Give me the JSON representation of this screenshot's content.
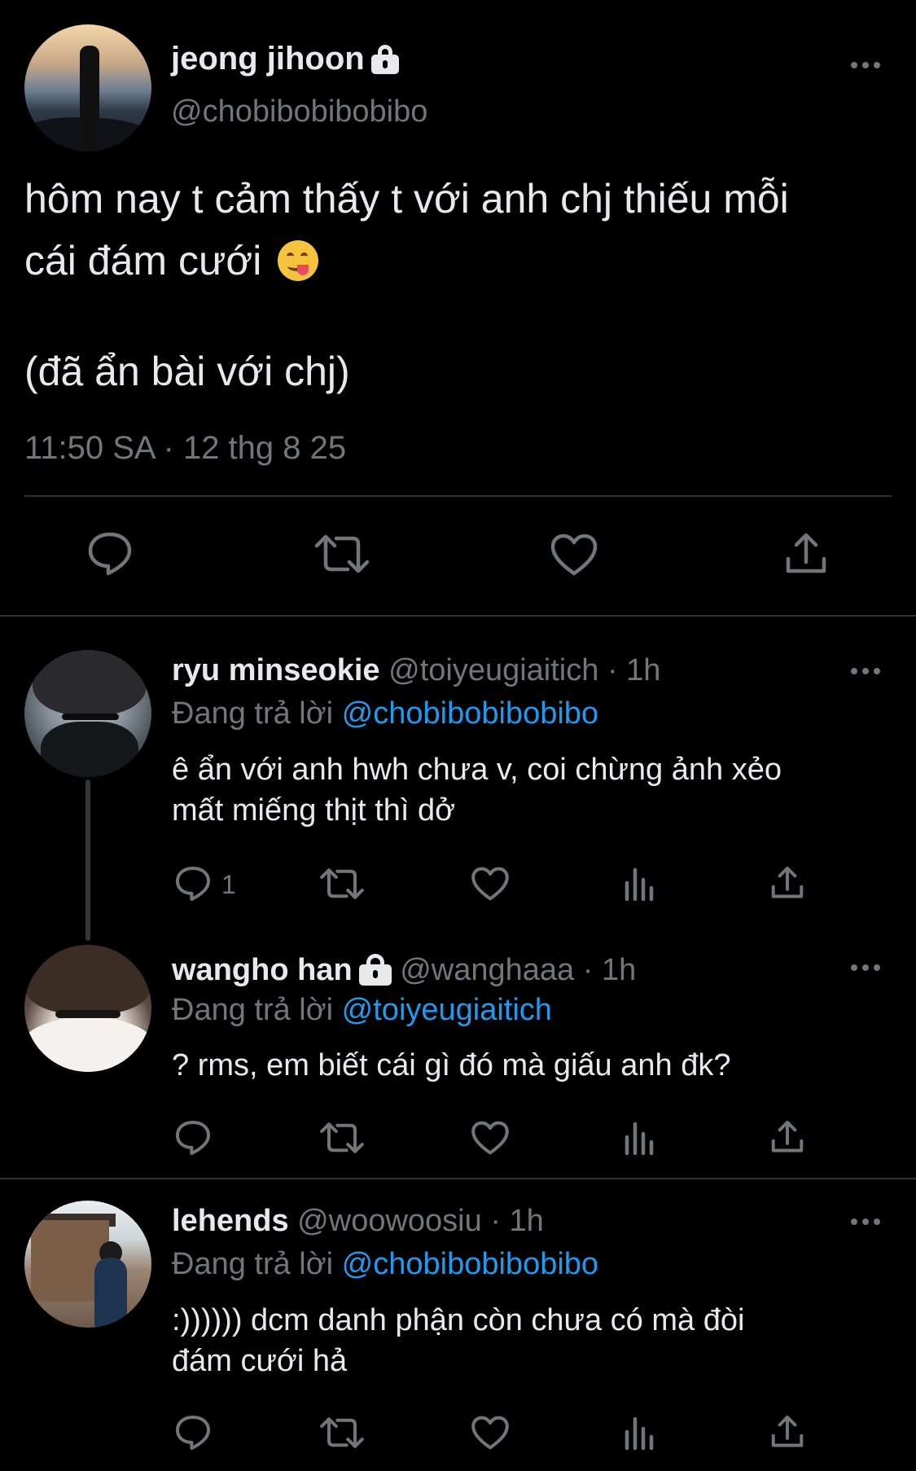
{
  "main_tweet": {
    "display_name": "jeong jihoon",
    "handle": "@chobibobibobibo",
    "text_line1": "hôm nay t cảm thấy t với anh chj thiếu mỗi",
    "text_line2": "cái đám cưới",
    "text_line3": "(đã ẩn bài với chj)",
    "emoji": "face-savoring-food",
    "timestamp": "11:50 SA · 12 thg 8 25",
    "protected": true
  },
  "replies": [
    {
      "display_name": "ryu minseokie",
      "handle": "@toiyeugiaitich",
      "time": "· 1h",
      "reply_prefix": "Đang trả lời",
      "reply_to": "@chobibobibobibo",
      "text_line1": "ê ẩn với anh hwh chưa v, coi chừng ảnh xẻo",
      "text_line2": "mất miếng thịt thì dở",
      "reply_count": "1"
    },
    {
      "display_name": "wangho han",
      "handle": "@wanghaaa",
      "time": "· 1h",
      "reply_prefix": "Đang trả lời",
      "reply_to": "@toiyeugiaitich",
      "text_line1": "? rms, em biết cái gì đó mà giấu anh đk?",
      "protected": true
    },
    {
      "display_name": "lehends",
      "handle": "@woowoosiu",
      "time": "· 1h",
      "reply_prefix": "Đang trả lời",
      "reply_to": "@chobibobibobibo",
      "text_line1": ":)))))) dcm danh phận còn chưa có mà đòi",
      "text_line2": "đám cưới hả"
    }
  ],
  "colors": {
    "background": "#000000",
    "text": "#e7e9ea",
    "muted": "#71767b",
    "link": "#1d9bf0",
    "divider": "#2f3336"
  }
}
